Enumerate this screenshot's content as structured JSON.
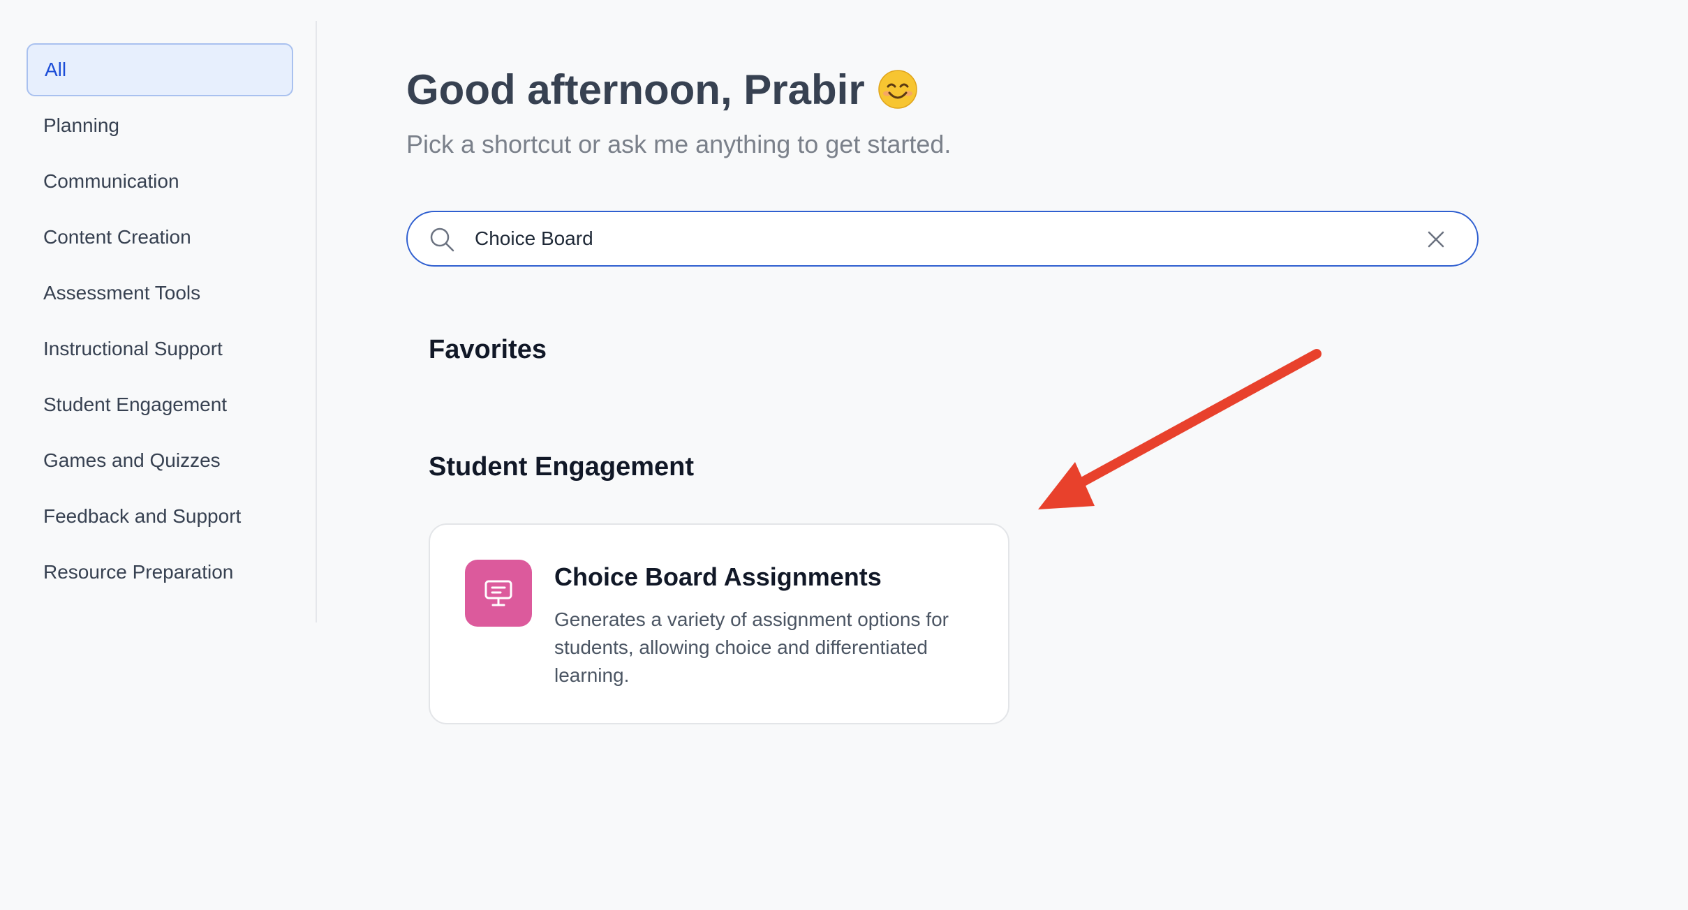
{
  "sidebar": {
    "items": [
      {
        "label": "All",
        "active": true
      },
      {
        "label": "Planning",
        "active": false
      },
      {
        "label": "Communication",
        "active": false
      },
      {
        "label": "Content Creation",
        "active": false
      },
      {
        "label": "Assessment Tools",
        "active": false
      },
      {
        "label": "Instructional Support",
        "active": false
      },
      {
        "label": "Student Engagement",
        "active": false
      },
      {
        "label": "Games and Quizzes",
        "active": false
      },
      {
        "label": "Feedback and Support",
        "active": false
      },
      {
        "label": "Resource Preparation",
        "active": false
      }
    ]
  },
  "header": {
    "greeting": "Good afternoon, Prabir",
    "emoji_icon": "smiling-face-icon",
    "subtitle": "Pick a shortcut or ask me anything to get started."
  },
  "search": {
    "value": "Choice Board",
    "icon": "search-icon",
    "clear_icon": "close-icon"
  },
  "sections": {
    "favorites": {
      "title": "Favorites"
    },
    "student_engagement": {
      "title": "Student Engagement",
      "cards": [
        {
          "title": "Choice Board Assignments",
          "description": "Generates a variety of assignment options for students, allowing choice and differentiated learning.",
          "icon": "presentation-board-icon",
          "icon_color": "#dc5a9c"
        }
      ]
    }
  },
  "annotation": {
    "arrow_color": "#e8412c"
  },
  "colors": {
    "accent": "#2f5fd0",
    "active_nav_bg": "#e7effd",
    "active_nav_text": "#1d4ed8"
  }
}
